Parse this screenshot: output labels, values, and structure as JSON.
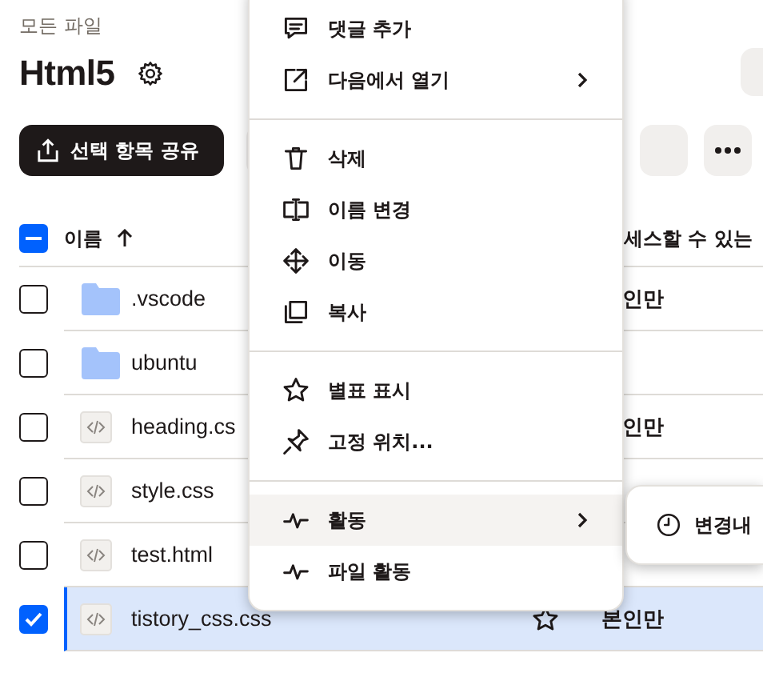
{
  "breadcrumb": "모든 파일",
  "folder": {
    "title": "Html5"
  },
  "toolbar": {
    "share_button": "선택 항목 공유"
  },
  "table": {
    "select_all": {
      "indeterminate": true
    },
    "sort_ascending": true,
    "columns": [
      {
        "label": "이름"
      },
      {
        "label": "세스할 수 있는"
      }
    ],
    "rows": [
      {
        "name": ".vscode",
        "kind": "folder",
        "access": "인만",
        "selected": false
      },
      {
        "name": "ubuntu",
        "kind": "folder",
        "selected": false
      },
      {
        "name": "heading.cs",
        "kind": "code",
        "access": "인만",
        "selected": false
      },
      {
        "name": "style.css",
        "kind": "code",
        "selected": false
      },
      {
        "name": "test.html",
        "kind": "code",
        "selected": false
      },
      {
        "name": "tistory_css.css",
        "kind": "code",
        "access": "본인만",
        "selected": true,
        "star_shown": true
      }
    ]
  },
  "context_menu": {
    "items": [
      {
        "kind": "item",
        "label": "댓글 추가",
        "has_submenu": false,
        "highlighted": false
      },
      {
        "kind": "item",
        "label": "다음에서 열기",
        "has_submenu": true,
        "highlighted": false
      },
      {
        "kind": "divider"
      },
      {
        "kind": "item",
        "label": "삭제",
        "has_submenu": false,
        "highlighted": false
      },
      {
        "kind": "item",
        "label": "이름 변경",
        "has_submenu": false,
        "highlighted": false
      },
      {
        "kind": "item",
        "label": "이동",
        "has_submenu": false,
        "highlighted": false
      },
      {
        "kind": "item",
        "label": "복사",
        "has_submenu": false,
        "highlighted": false
      },
      {
        "kind": "divider"
      },
      {
        "kind": "item",
        "label": "별표 표시",
        "has_submenu": false,
        "highlighted": false
      },
      {
        "kind": "item",
        "label": "고정 위치...",
        "has_submenu": false,
        "highlighted": false
      },
      {
        "kind": "divider"
      },
      {
        "kind": "item",
        "label": "활동",
        "has_submenu": true,
        "highlighted": true
      },
      {
        "kind": "item",
        "label": "파일 활동",
        "has_submenu": false,
        "highlighted": false
      }
    ]
  },
  "submenu": {
    "items": [
      {
        "label": "변경내"
      }
    ]
  }
}
